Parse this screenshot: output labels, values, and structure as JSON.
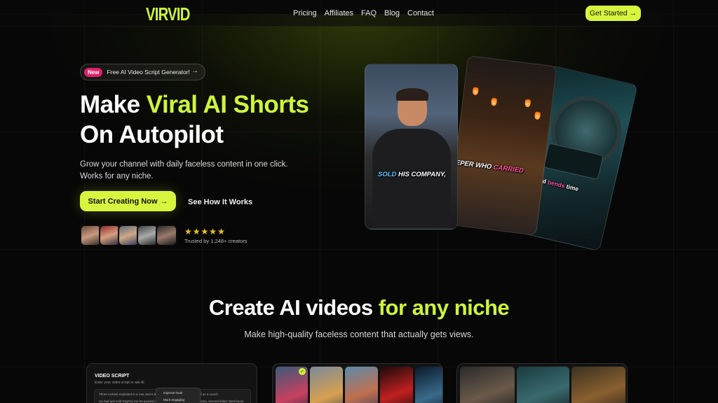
{
  "nav": {
    "logo": "VIRVID",
    "links": [
      "Pricing",
      "Affiliates",
      "FAQ",
      "Blog",
      "Contact"
    ],
    "cta_label": "Get Started",
    "cta_arrow": "→"
  },
  "hero": {
    "badge_label": "New",
    "badge_text": "Free AI Video Script Generator!",
    "badge_arrow": "→",
    "title_part1": "Make ",
    "title_accent": "Viral AI Shorts",
    "title_line2": "On Autopilot",
    "subtitle_line1": "Grow your channel with daily faceless content in one click.",
    "subtitle_line2": "Works for any niche.",
    "primary_cta": "Start Creating Now",
    "primary_arrow": "→",
    "secondary_cta": "See How It Works",
    "rating_stars": 5,
    "trusted_text": "Trusted by 1,248+ creators"
  },
  "video_cards": [
    {
      "caption_highlight": "SOLD",
      "caption_rest": " HIS COMPANY,"
    },
    {
      "caption_rest": "EEPER WHO ",
      "caption_highlight": "CARRIED"
    },
    {
      "caption_pre": "speed ",
      "caption_highlight": "bends",
      "caption_post": " time"
    }
  ],
  "section": {
    "title_part1": "Create AI videos ",
    "title_accent": "for any niche",
    "subtitle": "Make high-quality faceless content that actually gets views."
  },
  "script_panel": {
    "title": "VIDEO SCRIPT",
    "subtitle": "Enter your video script or ask AI",
    "line1": "Three rockets exploded in a row, and a billionaire w",
    "line1_end": "d on a couch.",
    "line2": "He had just sold PayPal, but he poured nearly every",
    "line2_end": "hires, second failed, third boom",
    "menu": [
      "Improve hook",
      "More engaging"
    ]
  },
  "colors": {
    "accent": "#cdf53a",
    "badge": "#e0206a",
    "star": "#f5c518"
  }
}
